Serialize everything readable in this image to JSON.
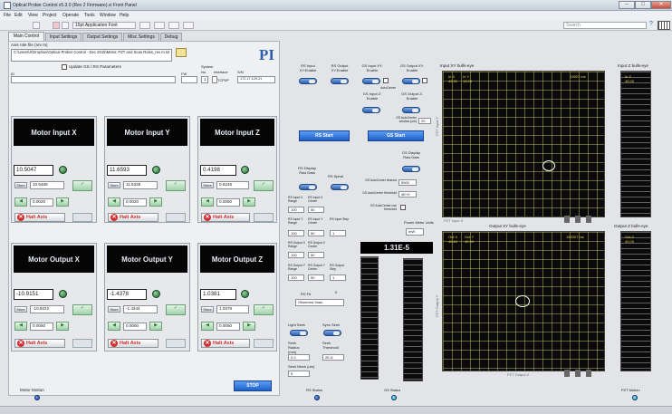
{
  "window": {
    "title": "Optical Prober Control v5.3.0 (Rev 2 Firmware).vi Front Panel"
  },
  "menu": [
    "File",
    "Edit",
    "View",
    "Project",
    "Operate",
    "Tools",
    "Window",
    "Help"
  ],
  "toolbar": {
    "font_label": "15pt Application Font",
    "search_placeholder": "Search"
  },
  "tabs": [
    "Main Control",
    "Input Settings",
    "Output Settings",
    "Misc Settings",
    "Debug"
  ],
  "main": {
    "axis_role_label": "Axis role file (rev m)",
    "path_value": "C:\\Users\\X\\Dropbox\\Optical Prober Control - Dec 2015\\Motor, PZT and Scan Roles_rev m.txt",
    "update_label": "Update GS / RS Parameters",
    "id_label": "ID",
    "fw_label": "FW",
    "system_label": "System",
    "no_label": "No.",
    "no_value": "1",
    "interface_label": "Interface",
    "interface_value": "TCP/IP",
    "sn_label": "S/N",
    "sn_value": "172.17.129.21",
    "logo": "PI"
  },
  "motors": [
    {
      "title": "Motor Input X",
      "position": "10.5047",
      "target": "10.5469",
      "step": "0.0020"
    },
    {
      "title": "Motor Input Y",
      "position": "11.6593",
      "target": "11.6336",
      "step": "0.0020"
    },
    {
      "title": "Motor Input Z",
      "position": "0.4198",
      "target": "0.5245",
      "step": "0.0050"
    },
    {
      "title": "Motor Output X",
      "position": "-10.9151",
      "target": "-10.9222",
      "step": "0.0050"
    },
    {
      "title": "Motor Output Y",
      "position": "-1.4378",
      "target": "-1.4344",
      "step": "0.0050"
    },
    {
      "title": "Motor Output Z",
      "position": "1.0381",
      "target": "1.0379",
      "step": "0.0050"
    }
  ],
  "motor_common": {
    "store_label": "Store",
    "halt_label": "Halt Axis",
    "stop_label": "STOP",
    "motion_label": "Motor Motion"
  },
  "rs": {
    "input_xy_label": "RS Input XY:Enable",
    "output_xy_label": "RS Output XY:Enable",
    "start_label": "RS Start",
    "display_label": "RS Display Raw Data",
    "spiral_label": "RS Spiral",
    "params": [
      {
        "label": "RS Input X Range",
        "value": "100"
      },
      {
        "label": "RS Input X Center",
        "value": "50"
      },
      {
        "label": "RS Input Y Range",
        "value": "100"
      },
      {
        "label": "RS Input Y Center",
        "value": "50"
      },
      {
        "label": "RS Input Step",
        "value": "1"
      },
      {
        "label": "RS Output X Range",
        "value": "100"
      },
      {
        "label": "RS Output X Center",
        "value": "50"
      },
      {
        "label": "RS Output Y Range",
        "value": "100"
      },
      {
        "label": "RS Output Y Center",
        "value": "50"
      },
      {
        "label": "RS Output Step",
        "value": "1"
      }
    ],
    "fit_label": "RS Fit",
    "fit_num": "0",
    "fit_value": "Observed Imax",
    "light_seek_label": "Light Seek",
    "sync_seek_label": "Sync Seek",
    "seek_radius_label": "Seek Radius (mm)",
    "seek_radius_value": "0.2",
    "seek_threshold_label": "Seek Threshold",
    "seek_threshold_value": "2E-6",
    "seek_mesh_label": "Seek Mesh (um)",
    "seek_mesh_value": "5",
    "status_label": "RS Status"
  },
  "gs": {
    "input_xy_label": "GS Input XY: Enable",
    "output_xy_label": "GS Output XY: Enable",
    "autocenter_label": "AutoCenter",
    "input_z_label": "GS Input Z: Enable",
    "output_z_label": "GS Output Z: Enable",
    "ac_window_label": "GS AutoCenter window (um)",
    "ac_window_value": "20",
    "start_label": "GS Start",
    "display_label": "GS Display Raw Data",
    "timeout_label": "GS AutoCenter timeout",
    "timeout_value": "5000",
    "threshold_label": "GS AutoCenter threshold",
    "threshold_value": "4E+0",
    "use_threshold_label": "GS AutoCenter use threshold",
    "power_meter_label": "Power Meter Units",
    "power_units": "mW",
    "power_value": "1.31E-5",
    "status_label": "GS Status"
  },
  "bullseye": {
    "input_title": "Input XY bulls-eye",
    "input_z_title": "Input Z bulls-eye",
    "output_title": "Output XY bulls-eye",
    "output_z_title": "Output Z bulls-eye",
    "in_x": "In X",
    "in_x_val": "49.31",
    "in_y": "In Y",
    "in_y_val": "13.03",
    "in_z": "In Z",
    "in_z_val": "45.00",
    "in_time": "13507 ms",
    "out_x": "Out X",
    "out_x_val": "45.84",
    "out_y": "Out Y",
    "out_y_val": "45.99",
    "out_z": "Out Z",
    "out_z_val": "40.00",
    "out_time": "159307 ms",
    "pzt_in_x": "PZT Input X",
    "pzt_in_y": "PZT Input Y",
    "pzt_out_x": "PZT Output X",
    "pzt_out_y": "PZT Output Y",
    "pzt_motion_label": "PZT Motion"
  },
  "colors": {
    "accent": "#2d5fae",
    "halt": "#d02a2a",
    "display_bg": "#050505",
    "grid": "#e6d54a"
  },
  "icons": [
    "folder-icon",
    "run-icon",
    "abort-icon",
    "pause-icon",
    "search-icon",
    "help-icon",
    "ring-spinner-icon"
  ]
}
